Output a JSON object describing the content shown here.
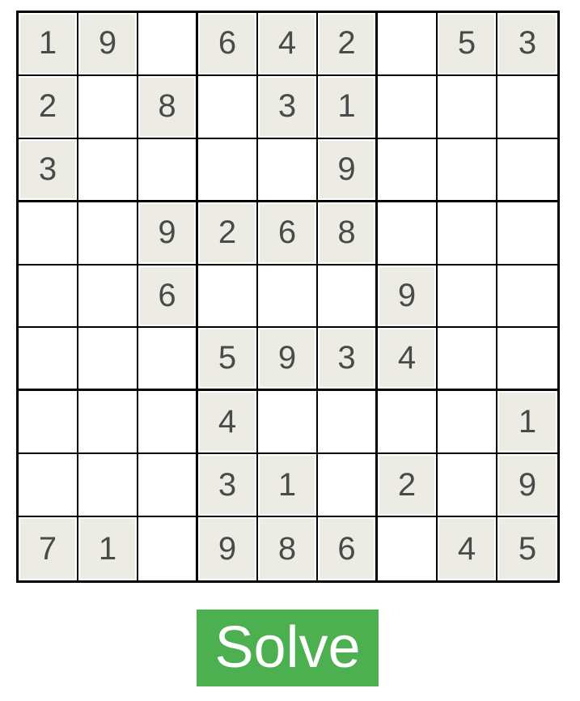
{
  "board": {
    "rows": [
      [
        "1",
        "9",
        "",
        "6",
        "4",
        "2",
        "",
        "5",
        "3"
      ],
      [
        "2",
        "",
        "8",
        "",
        "3",
        "1",
        "",
        "",
        ""
      ],
      [
        "3",
        "",
        "",
        "",
        "",
        "9",
        "",
        "",
        ""
      ],
      [
        "",
        "",
        "9",
        "2",
        "6",
        "8",
        "",
        "",
        ""
      ],
      [
        "",
        "",
        "6",
        "",
        "",
        "",
        "9",
        "",
        ""
      ],
      [
        "",
        "",
        "",
        "5",
        "9",
        "3",
        "4",
        "",
        ""
      ],
      [
        "",
        "",
        "",
        "4",
        "",
        "",
        "",
        "",
        "1"
      ],
      [
        "",
        "",
        "",
        "3",
        "1",
        "",
        "2",
        "",
        "9"
      ],
      [
        "7",
        "1",
        "",
        "9",
        "8",
        "6",
        "",
        "4",
        "5"
      ]
    ],
    "colors": {
      "given_background": "#ecebe4",
      "digit": "#4a4a4a",
      "grid_line": "#000000"
    }
  },
  "actions": {
    "solve_label": "Solve",
    "solve_color": "#4caf50"
  }
}
